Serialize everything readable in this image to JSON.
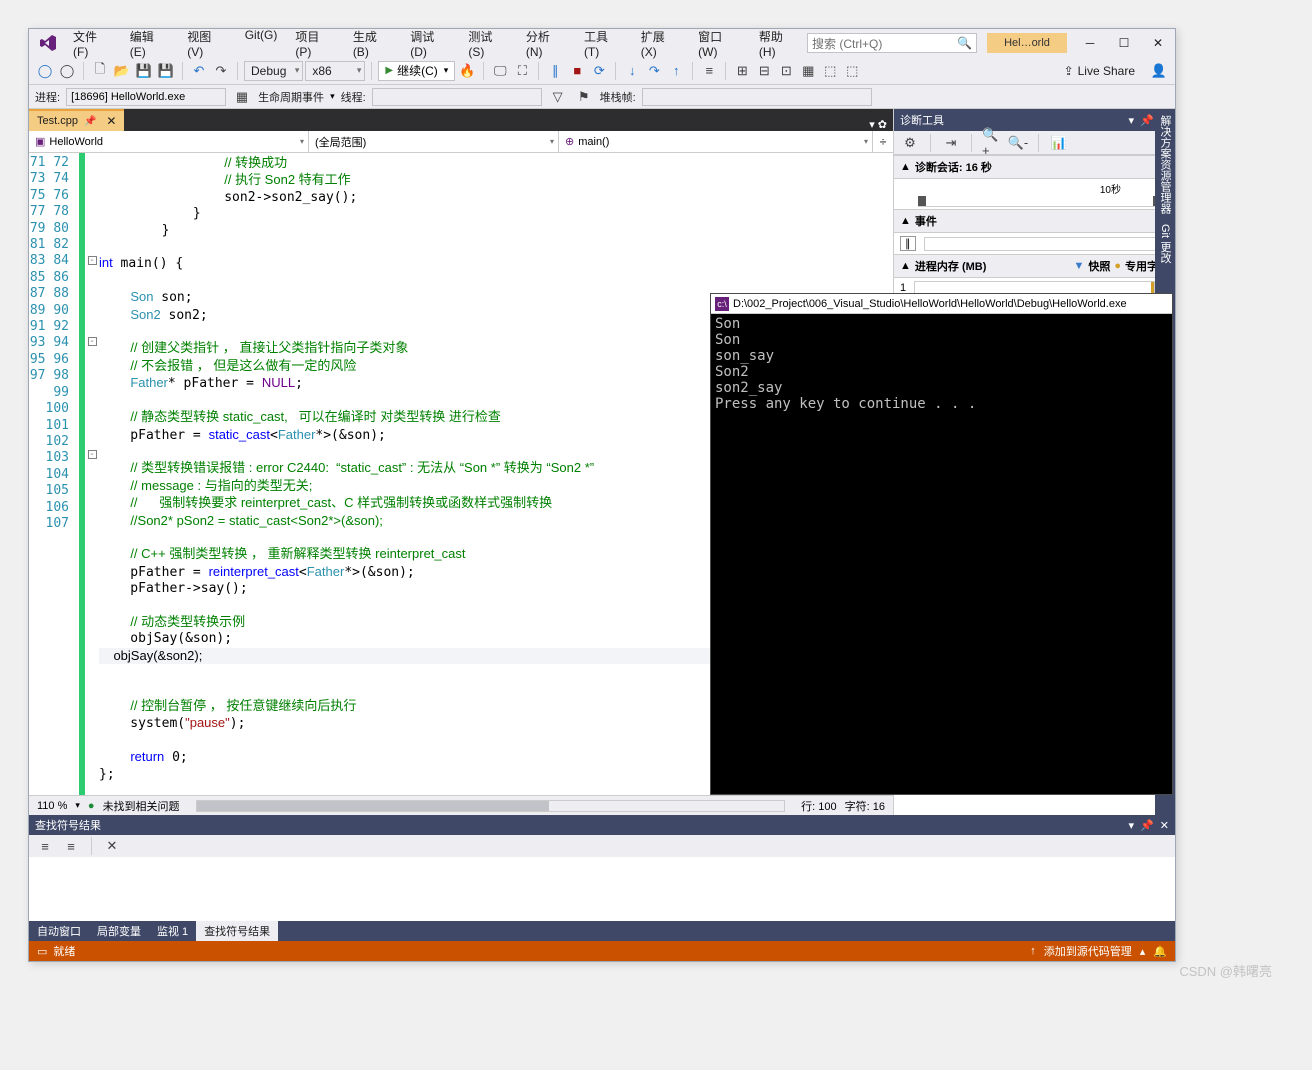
{
  "menu": [
    "文件(F)",
    "编辑(E)",
    "视图(V)",
    "Git(G)",
    "项目(P)",
    "生成(B)",
    "调试(D)",
    "测试(S)",
    "分析(N)",
    "工具(T)",
    "扩展(X)",
    "窗口(W)",
    "帮助(H)"
  ],
  "search_placeholder": "搜索 (Ctrl+Q)",
  "title_segment": "Hel…orld",
  "tb_config": "Debug",
  "tb_platform": "x86",
  "tb_continue": "继续(C)",
  "tb_liveshare": "Live Share",
  "tb2_process_lbl": "进程:",
  "tb2_process_val": "[18696] HelloWorld.exe",
  "tb2_lifecycle": "生命周期事件",
  "tb2_thread_lbl": "线程:",
  "tb2_stackframe": "堆栈帧:",
  "file_tab": "Test.cpp",
  "nav_scope1": "HelloWorld",
  "nav_scope2": "(全局范围)",
  "nav_scope3": "main()",
  "line_start": 71,
  "line_end": 107,
  "code_lines": [
    {
      "t": "                <span class='cm'>// 转换成功</span>"
    },
    {
      "t": "                <span class='cm'>// 执行 Son2 特有工作</span>"
    },
    {
      "t": "                son2-&gt;son2_say();"
    },
    {
      "t": "            }"
    },
    {
      "t": "        }"
    },
    {
      "t": ""
    },
    {
      "t": "<span class='kw'>int</span> main() {",
      "fold": true
    },
    {
      "t": ""
    },
    {
      "t": "    <span class='ty'>Son</span> son;"
    },
    {
      "t": "    <span class='ty'>Son2</span> son2;"
    },
    {
      "t": ""
    },
    {
      "t": "    <span class='cm'>// 创建父类指针 ， 直接让父类指针指向子类对象</span>",
      "fold": true
    },
    {
      "t": "    <span class='cm'>// 不会报错 ， 但是这么做有一定的风险</span>"
    },
    {
      "t": "    <span class='ty'>Father</span>* pFather = <span class='mac'>NULL</span>;"
    },
    {
      "t": ""
    },
    {
      "t": "    <span class='cm'>// 静态类型转换 static_cast,   可以在编译时 对类型转换 进行检查</span>"
    },
    {
      "t": "    pFather = <span class='kw'>static_cast</span>&lt;<span class='ty'>Father</span>*&gt;(&amp;son);"
    },
    {
      "t": ""
    },
    {
      "t": "    <span class='cm'>// 类型转换错误报错 : error C2440:  “static_cast” : 无法从 “Son *” 转换为 “Son2 *”</span>",
      "fold": true
    },
    {
      "t": "    <span class='cm'>// message : 与指向的类型无关;</span>"
    },
    {
      "t": "    <span class='cm'>//      强制转换要求 reinterpret_cast、C 样式强制转换或函数样式强制转换</span>"
    },
    {
      "t": "    <span class='cm'>//Son2* pSon2 = static_cast&lt;Son2*&gt;(&amp;son);</span>"
    },
    {
      "t": ""
    },
    {
      "t": "    <span class='cm'>// C++ 强制类型转换 ， 重新解释类型转换 reinterpret_cast</span>"
    },
    {
      "t": "    pFather = <span class='kw'>reinterpret_cast</span>&lt;<span class='ty'>Father</span>*&gt;(&amp;son);"
    },
    {
      "t": "    pFather-&gt;say();"
    },
    {
      "t": ""
    },
    {
      "t": "    <span class='cm'>// 动态类型转换示例</span>"
    },
    {
      "t": "    objSay(&amp;son);"
    },
    {
      "t": "    objSay(&amp;son2);",
      "hl": true
    },
    {
      "t": ""
    },
    {
      "t": ""
    },
    {
      "t": "    <span class='cm'>// 控制台暂停 ， 按任意键继续向后执行</span>"
    },
    {
      "t": "    system(<span class='st'>\"pause\"</span>);"
    },
    {
      "t": ""
    },
    {
      "t": "    <span class='kw'>return</span> 0;"
    },
    {
      "t": "};"
    }
  ],
  "zoom": "110 %",
  "issues": "未找到相关问题",
  "cursor_line": "行: 100",
  "cursor_char": "字符: 16",
  "diag_title": "诊断工具",
  "diag_session": "诊断会话: 16 秒",
  "diag_ruler_label": "10秒",
  "diag_events": "事件",
  "diag_mem": "进程内存 (MB)",
  "diag_snapshot": "快照",
  "diag_private": "专用字节",
  "diag_mem_val": "1",
  "bottom_title": "查找符号结果",
  "bottom_tabs": [
    "自动窗口",
    "局部变量",
    "监视 1",
    "查找符号结果"
  ],
  "status_ready": "就绪",
  "status_scm": "添加到源代码管理",
  "vstrip_items": [
    "解决方案资源管理器",
    "Git 更改"
  ],
  "console_title": "D:\\002_Project\\006_Visual_Studio\\HelloWorld\\HelloWorld\\Debug\\HelloWorld.exe",
  "console_lines": [
    "Son",
    "Son",
    "son_say",
    "Son2",
    "son2_say",
    "Press any key to continue . . ."
  ],
  "watermark": "CSDN @韩曙亮"
}
